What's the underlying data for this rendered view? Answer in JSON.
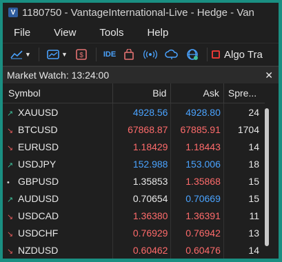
{
  "window": {
    "title": "1180750 - VantageInternational-Live - Hedge - Van",
    "app_icon": "metatrader-icon"
  },
  "menu": [
    "File",
    "View",
    "Tools",
    "Help"
  ],
  "toolbar": {
    "ide_label": "IDE",
    "algo_label": "Algo Tra"
  },
  "market_watch": {
    "title": "Market Watch: 13:24:00",
    "columns": [
      "Symbol",
      "Bid",
      "Ask",
      "Spre..."
    ],
    "rows": [
      {
        "symbol": "XAUUSD",
        "bid": "4928.56",
        "ask": "4928.80",
        "spread": "24",
        "dir": "up",
        "bid_color": "blue",
        "ask_color": "blue"
      },
      {
        "symbol": "BTCUSD",
        "bid": "67868.87",
        "ask": "67885.91",
        "spread": "1704",
        "dir": "down",
        "bid_color": "red",
        "ask_color": "red"
      },
      {
        "symbol": "EURUSD",
        "bid": "1.18429",
        "ask": "1.18443",
        "spread": "14",
        "dir": "down",
        "bid_color": "red",
        "ask_color": "red"
      },
      {
        "symbol": "USDJPY",
        "bid": "152.988",
        "ask": "153.006",
        "spread": "18",
        "dir": "up",
        "bid_color": "blue",
        "ask_color": "blue"
      },
      {
        "symbol": "GBPUSD",
        "bid": "1.35853",
        "ask": "1.35868",
        "spread": "15",
        "dir": "flat",
        "bid_color": "white",
        "ask_color": "red"
      },
      {
        "symbol": "AUDUSD",
        "bid": "0.70654",
        "ask": "0.70669",
        "spread": "15",
        "dir": "up",
        "bid_color": "white",
        "ask_color": "blue"
      },
      {
        "symbol": "USDCAD",
        "bid": "1.36380",
        "ask": "1.36391",
        "spread": "11",
        "dir": "down",
        "bid_color": "red",
        "ask_color": "red"
      },
      {
        "symbol": "USDCHF",
        "bid": "0.76929",
        "ask": "0.76942",
        "spread": "13",
        "dir": "down",
        "bid_color": "red",
        "ask_color": "red"
      },
      {
        "symbol": "NZDUSD",
        "bid": "0.60462",
        "ask": "0.60476",
        "spread": "14",
        "dir": "down",
        "bid_color": "red",
        "ask_color": "red"
      }
    ]
  },
  "colors": {
    "up": "#3fbf9a",
    "down": "#e05a5a",
    "blue": "#4aa3ff",
    "red": "#ff6b6b",
    "background": "#1f1f1f",
    "frame": "#1a8f82"
  }
}
